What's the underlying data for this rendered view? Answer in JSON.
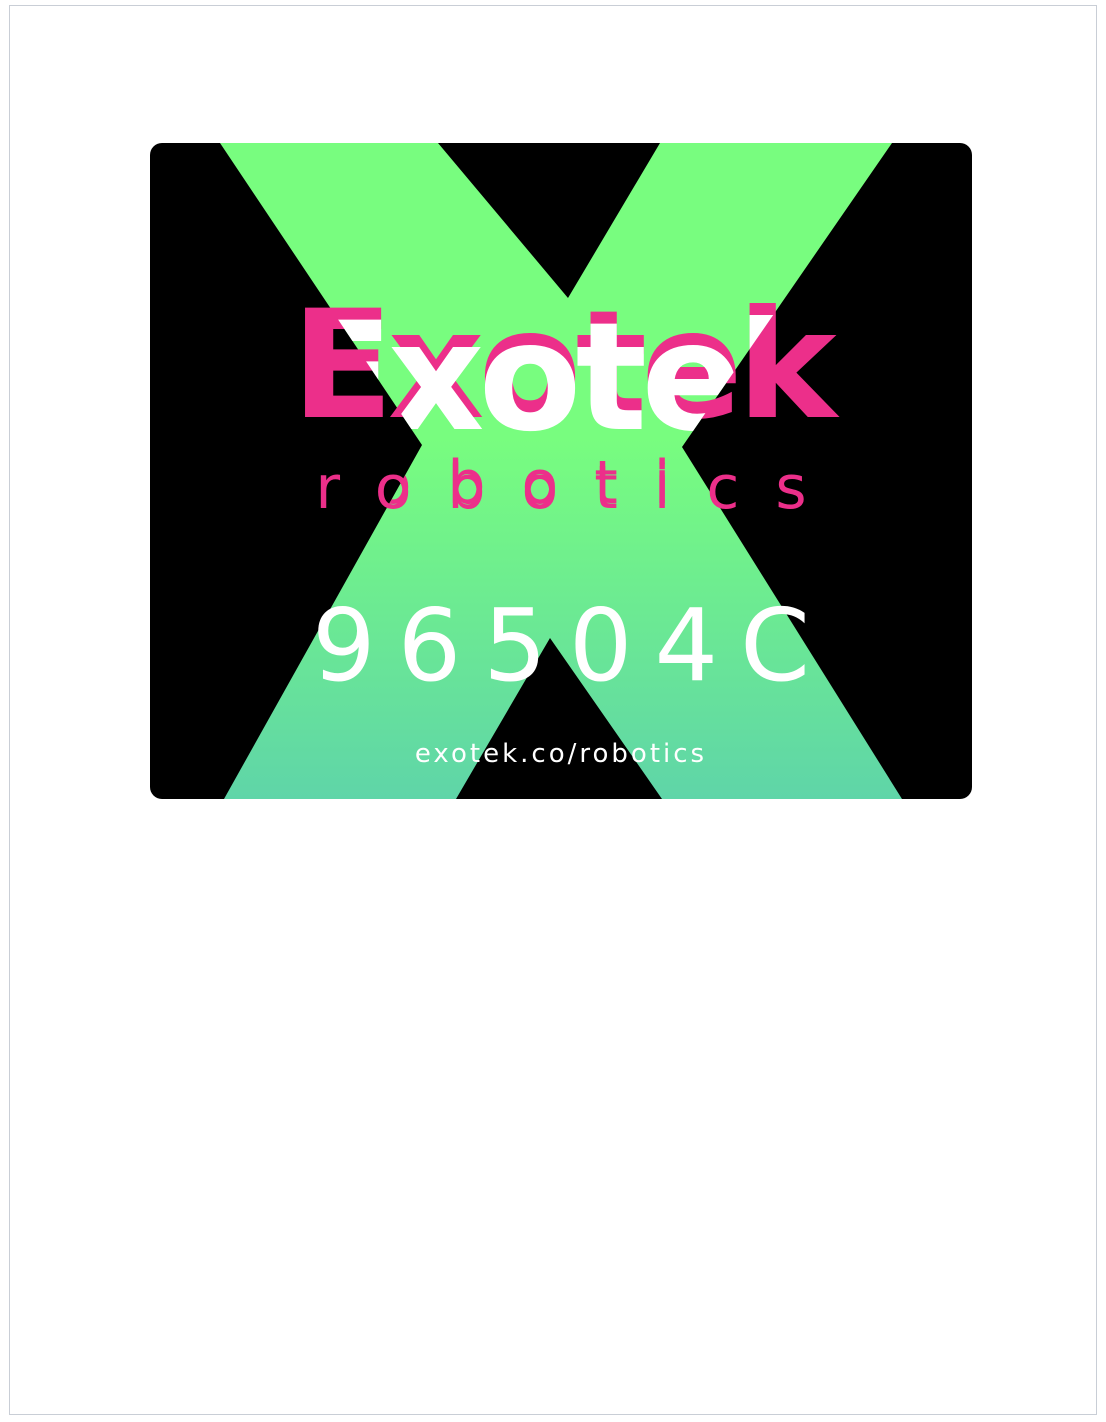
{
  "logo": {
    "name": "Exotek",
    "tagline": "robotics",
    "code": "96504C",
    "url": "exotek.co/robotics"
  },
  "colors": {
    "background": "#000000",
    "accent_green_top": "#78fd7f",
    "accent_green_bottom": "#5fd5a8",
    "brand_pink": "#ec2f8a",
    "text_white": "#ffffff"
  }
}
